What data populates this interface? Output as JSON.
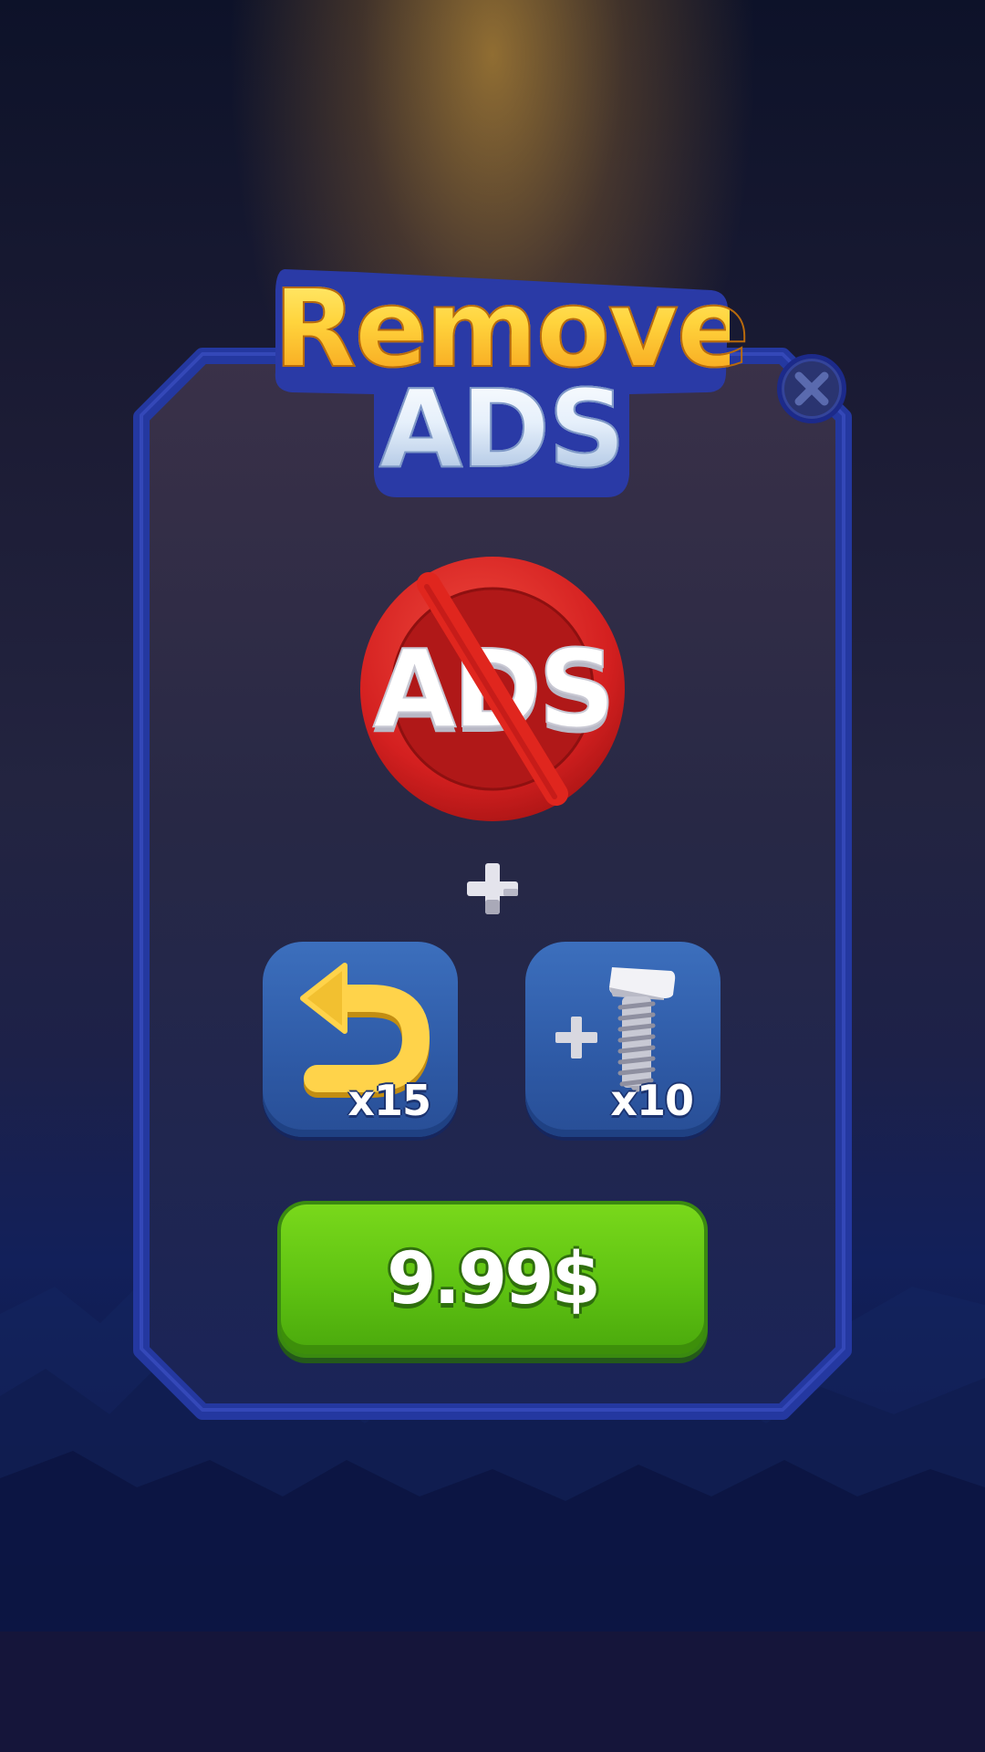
{
  "title": {
    "line1": "Remove",
    "line2": "ADS"
  },
  "close": {
    "icon": "close-icon"
  },
  "offer": {
    "main_icon": "no-ads-icon",
    "main_icon_text": "ADS",
    "plus_icon": "plus-icon",
    "rewards": [
      {
        "icon": "undo-arrow-icon",
        "count": "x15"
      },
      {
        "icon": "screw-icon",
        "count": "x10"
      }
    ]
  },
  "buy_button": {
    "price": "9.99$"
  },
  "colors": {
    "panel_border": "#2438a0",
    "title_gold": "#ffd43d",
    "buy_green": "#5ec212",
    "tile_blue": "#3060aa",
    "no_ads_red": "#d42020"
  }
}
